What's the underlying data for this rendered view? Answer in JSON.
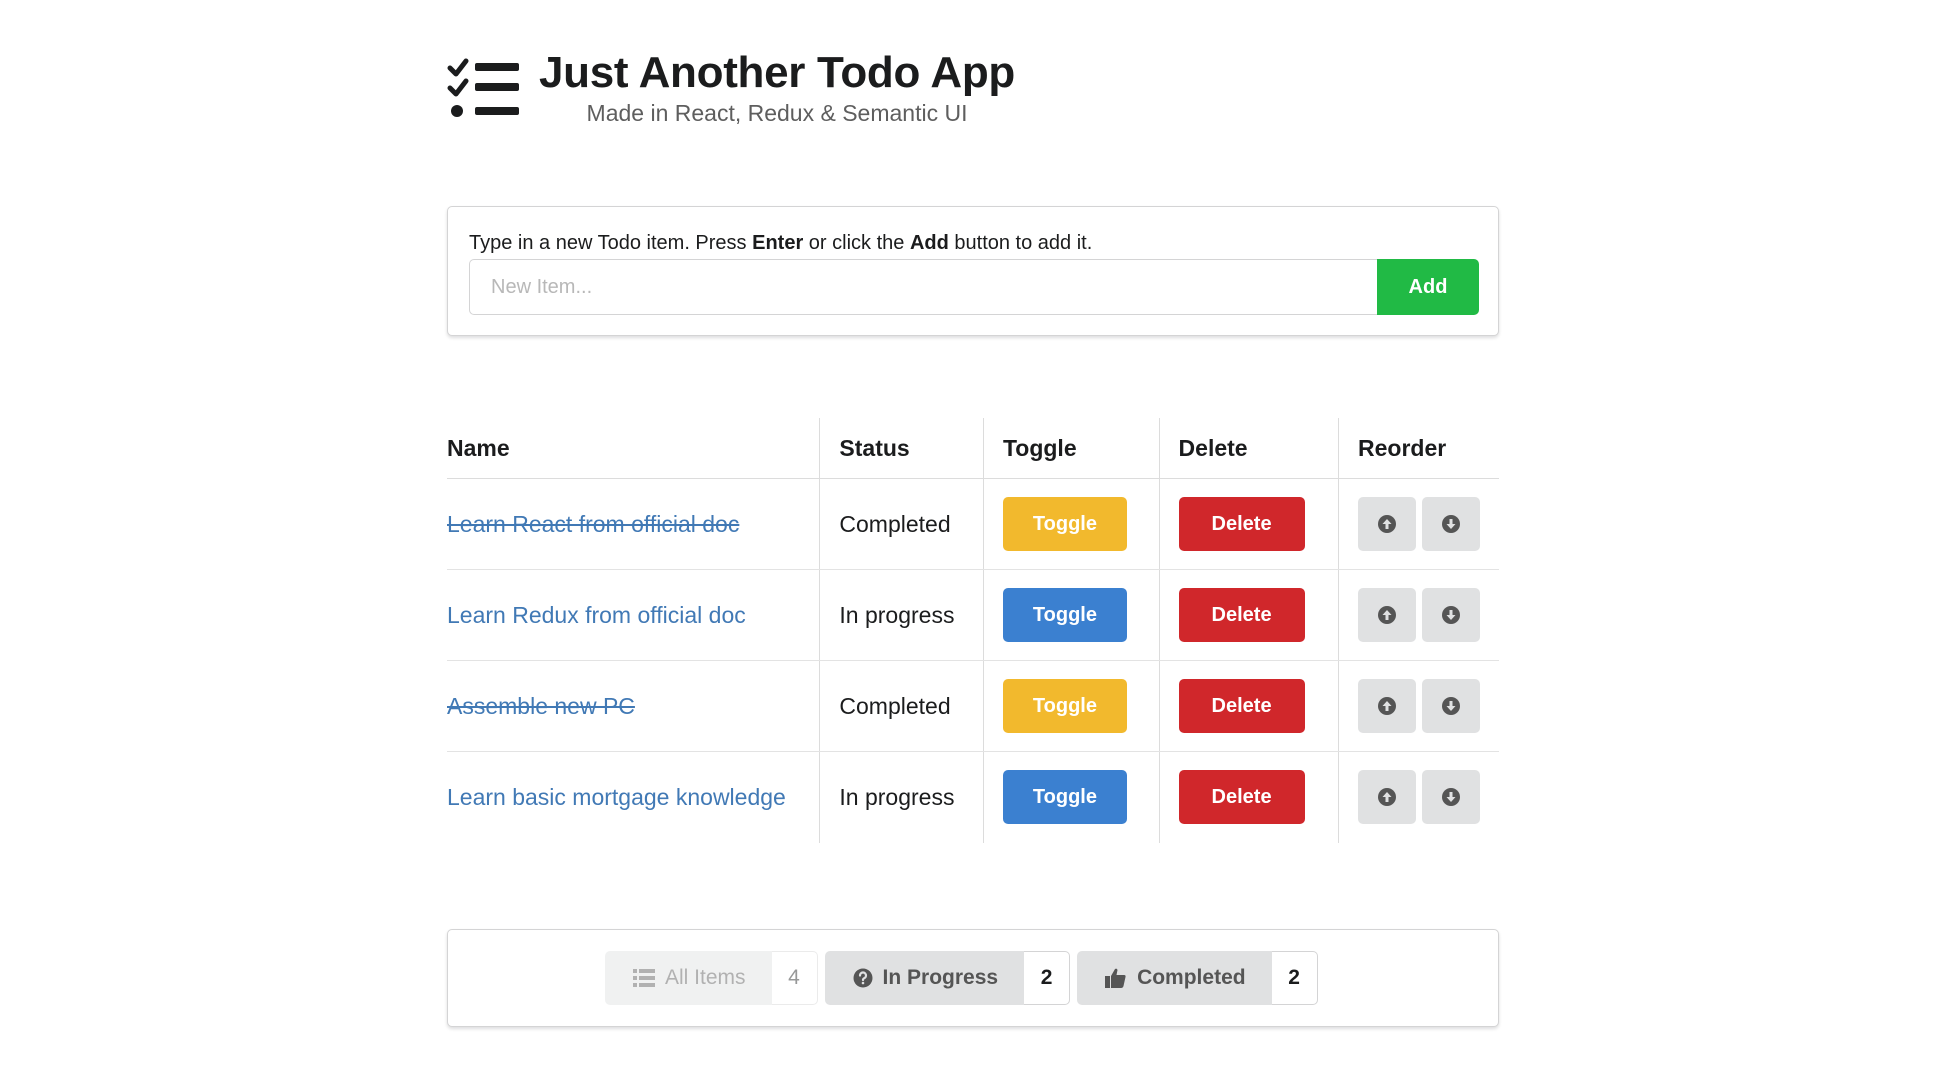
{
  "header": {
    "title": "Just Another Todo App",
    "subtitle": "Made in React, Redux & Semantic UI",
    "logo_icon": "tasks-icon"
  },
  "add_form": {
    "hint_prefix": "Type in a new Todo item. Press ",
    "hint_key1": "Enter",
    "hint_middle": " or click the ",
    "hint_key2": "Add",
    "hint_suffix": " button to add it.",
    "input_value": "",
    "input_placeholder": "New Item...",
    "add_label": "Add",
    "add_color": "#21ba45"
  },
  "table": {
    "headers": [
      "Name",
      "Status",
      "Toggle",
      "Delete",
      "Reorder"
    ],
    "rows": [
      {
        "name": "Learn React from official doc",
        "status": "Completed",
        "completed": true,
        "toggle_label": "Toggle",
        "delete_label": "Delete"
      },
      {
        "name": "Learn Redux from official doc",
        "status": "In progress",
        "completed": false,
        "toggle_label": "Toggle",
        "delete_label": "Delete"
      },
      {
        "name": "Assemble new PC",
        "status": "Completed",
        "completed": true,
        "toggle_label": "Toggle",
        "delete_label": "Delete"
      },
      {
        "name": "Learn basic mortgage knowledge",
        "status": "In progress",
        "completed": false,
        "toggle_label": "Toggle",
        "delete_label": "Delete"
      }
    ],
    "colors": {
      "toggle_completed": "#f2b92d",
      "toggle_in_progress": "#3b80d0",
      "delete": "#d0272b",
      "link": "#4179b5"
    },
    "reorder_icons": [
      "arrow-circle-up-icon",
      "arrow-circle-down-icon"
    ]
  },
  "filters": [
    {
      "label": "All Items",
      "count": "4",
      "icon": "list-icon",
      "active": false
    },
    {
      "label": "In Progress",
      "count": "2",
      "icon": "question-circle-icon",
      "active": true
    },
    {
      "label": "Completed",
      "count": "2",
      "icon": "thumbs-up-icon",
      "active": true
    }
  ]
}
